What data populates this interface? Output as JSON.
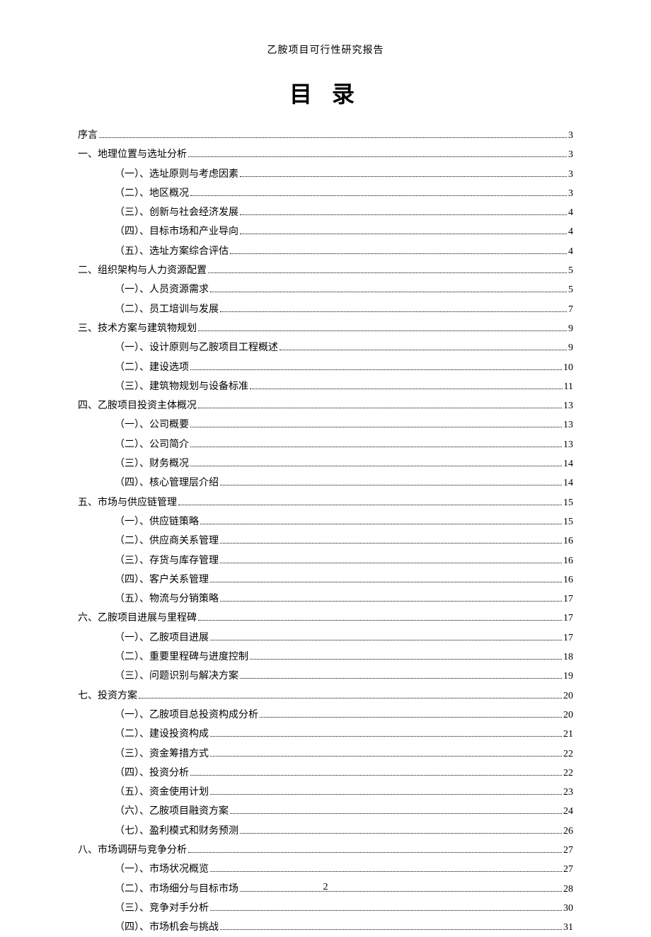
{
  "header": "乙胺项目可行性研究报告",
  "title": "目 录",
  "page_number": "2",
  "toc": [
    {
      "level": 1,
      "label": "序言",
      "page": "3"
    },
    {
      "level": 1,
      "label": "一、地理位置与选址分析",
      "page": "3"
    },
    {
      "level": 2,
      "label": "（一）、选址原则与考虑因素",
      "page": "3"
    },
    {
      "level": 2,
      "label": "（二）、地区概况",
      "page": "3"
    },
    {
      "level": 2,
      "label": "（三）、创新与社会经济发展",
      "page": "4"
    },
    {
      "level": 2,
      "label": "（四）、目标市场和产业导向",
      "page": "4"
    },
    {
      "level": 2,
      "label": "（五）、选址方案综合评估",
      "page": "4"
    },
    {
      "level": 1,
      "label": "二、组织架构与人力资源配置",
      "page": "5"
    },
    {
      "level": 2,
      "label": "（一）、人员资源需求",
      "page": "5"
    },
    {
      "level": 2,
      "label": "（二）、员工培训与发展",
      "page": "7"
    },
    {
      "level": 1,
      "label": "三、技术方案与建筑物规划",
      "page": "9"
    },
    {
      "level": 2,
      "label": "（一）、设计原则与乙胺项目工程概述",
      "page": "9"
    },
    {
      "level": 2,
      "label": "（二）、建设选项",
      "page": "10"
    },
    {
      "level": 2,
      "label": "（三）、建筑物规划与设备标准",
      "page": "11"
    },
    {
      "level": 1,
      "label": "四、乙胺项目投资主体概况",
      "page": "13"
    },
    {
      "level": 2,
      "label": "（一）、公司概要",
      "page": "13"
    },
    {
      "level": 2,
      "label": "（二）、公司简介",
      "page": "13"
    },
    {
      "level": 2,
      "label": "（三）、财务概况",
      "page": "14"
    },
    {
      "level": 2,
      "label": "（四）、核心管理层介绍",
      "page": "14"
    },
    {
      "level": 1,
      "label": "五、市场与供应链管理",
      "page": "15"
    },
    {
      "level": 2,
      "label": "（一）、供应链策略",
      "page": "15"
    },
    {
      "level": 2,
      "label": "（二）、供应商关系管理",
      "page": "16"
    },
    {
      "level": 2,
      "label": "（三）、存货与库存管理",
      "page": "16"
    },
    {
      "level": 2,
      "label": "（四）、客户关系管理",
      "page": "16"
    },
    {
      "level": 2,
      "label": "（五）、物流与分销策略",
      "page": "17"
    },
    {
      "level": 1,
      "label": "六、乙胺项目进展与里程碑",
      "page": "17"
    },
    {
      "level": 2,
      "label": "（一）、乙胺项目进展",
      "page": "17"
    },
    {
      "level": 2,
      "label": "（二）、重要里程碑与进度控制",
      "page": "18"
    },
    {
      "level": 2,
      "label": "（三）、问题识别与解决方案",
      "page": "19"
    },
    {
      "level": 1,
      "label": "七、投资方案",
      "page": "20"
    },
    {
      "level": 2,
      "label": "（一）、乙胺项目总投资构成分析",
      "page": "20"
    },
    {
      "level": 2,
      "label": "（二）、建设投资构成",
      "page": "21"
    },
    {
      "level": 2,
      "label": "（三）、资金筹措方式",
      "page": "22"
    },
    {
      "level": 2,
      "label": "（四）、投资分析",
      "page": "22"
    },
    {
      "level": 2,
      "label": "（五）、资金使用计划",
      "page": "23"
    },
    {
      "level": 2,
      "label": "（六）、乙胺项目融资方案",
      "page": "24"
    },
    {
      "level": 2,
      "label": "（七）、盈利模式和财务预测",
      "page": "26"
    },
    {
      "level": 1,
      "label": "八、市场调研与竞争分析",
      "page": "27"
    },
    {
      "level": 2,
      "label": "（一）、市场状况概览",
      "page": "27"
    },
    {
      "level": 2,
      "label": "（二）、市场细分与目标市场",
      "page": "28"
    },
    {
      "level": 2,
      "label": "（三）、竞争对手分析",
      "page": "30"
    },
    {
      "level": 2,
      "label": "（四）、市场机会与挑战",
      "page": "31"
    }
  ]
}
